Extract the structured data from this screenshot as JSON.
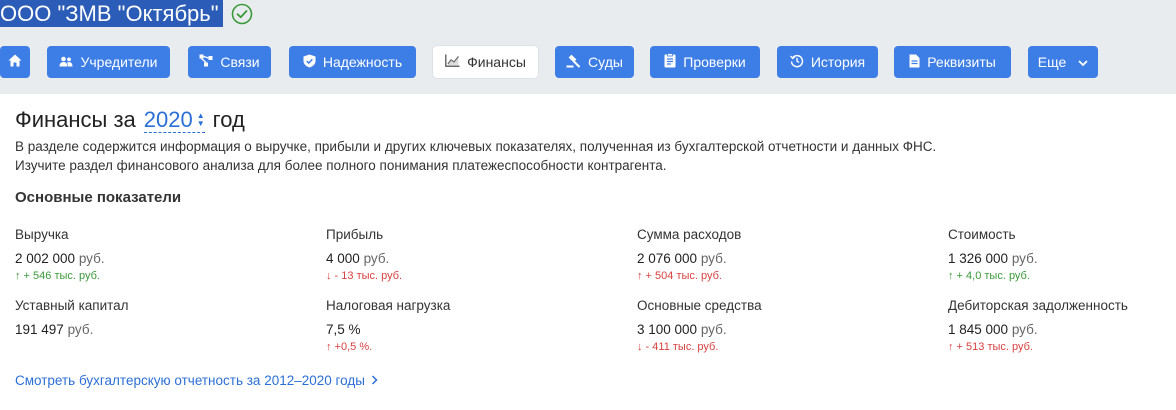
{
  "company": {
    "name": "ООО \"ЗМВ \"Октябрь\"",
    "verified_icon": "check-circle-icon"
  },
  "nav": {
    "home_icon": "home-icon",
    "items": [
      {
        "label": "Учредители",
        "icon": "users-icon"
      },
      {
        "label": "Связи",
        "icon": "network-icon"
      },
      {
        "label": "Надежность",
        "icon": "shield-icon"
      },
      {
        "label": "Финансы",
        "icon": "chart-icon",
        "active": true
      },
      {
        "label": "Суды",
        "icon": "gavel-icon"
      },
      {
        "label": "Проверки",
        "icon": "clipboard-icon"
      },
      {
        "label": "История",
        "icon": "history-icon"
      },
      {
        "label": "Реквизиты",
        "icon": "document-icon"
      },
      {
        "label": "Еще",
        "icon": "chevron-down-icon"
      }
    ]
  },
  "finance": {
    "title_prefix": "Финансы за",
    "year": "2020",
    "title_suffix": "год",
    "description": "В разделе содержится информация о выручке, прибыли и других ключевых показателях, полученная из бухгалтерской отчетности и данных ФНС. Изучите раздел финансового анализа для более полного понимания платежеспособности контрагента.",
    "section_title": "Основные показатели",
    "metrics": [
      {
        "label": "Выручка",
        "value": "2 002 000",
        "unit": "руб.",
        "delta": "↑ + 546 тыс. руб.",
        "delta_type": "up-green"
      },
      {
        "label": "Прибыль",
        "value": "4 000",
        "unit": "руб.",
        "delta": "↓ - 13 тыс. руб.",
        "delta_type": "down-red"
      },
      {
        "label": "Сумма расходов",
        "value": "2 076 000",
        "unit": "руб.",
        "delta": "↑ + 504 тыс. руб.",
        "delta_type": "up-red"
      },
      {
        "label": "Стоимость",
        "value": "1 326 000",
        "unit": "руб.",
        "delta": "↑ + 4,0 тыс. руб.",
        "delta_type": "up-green"
      },
      {
        "label": "Уставный капитал",
        "value": "191 497",
        "unit": "руб.",
        "delta": "",
        "delta_type": ""
      },
      {
        "label": "Налоговая нагрузка",
        "value": "7,5 %",
        "unit": "",
        "delta": "↑ +0,5 %.",
        "delta_type": "up-red"
      },
      {
        "label": "Основные средства",
        "value": "3 100 000",
        "unit": "руб.",
        "delta": "↓ - 411 тыс. руб.",
        "delta_type": "down-red"
      },
      {
        "label": "Дебиторская задолженность",
        "value": "1 845 000",
        "unit": "руб.",
        "delta": "↑ + 513 тыс. руб.",
        "delta_type": "up-red"
      }
    ],
    "report_link": "Смотреть бухгалтерскую отчетность за 2012–2020 годы",
    "report_link_icon": "chevron-right-icon"
  },
  "colors": {
    "nav_blue": "#3d7ee6",
    "title_highlight": "#2b5cb8",
    "link_blue": "#2b6fd6",
    "positive_green": "#3a9a3a",
    "negative_red": "#d94040"
  }
}
